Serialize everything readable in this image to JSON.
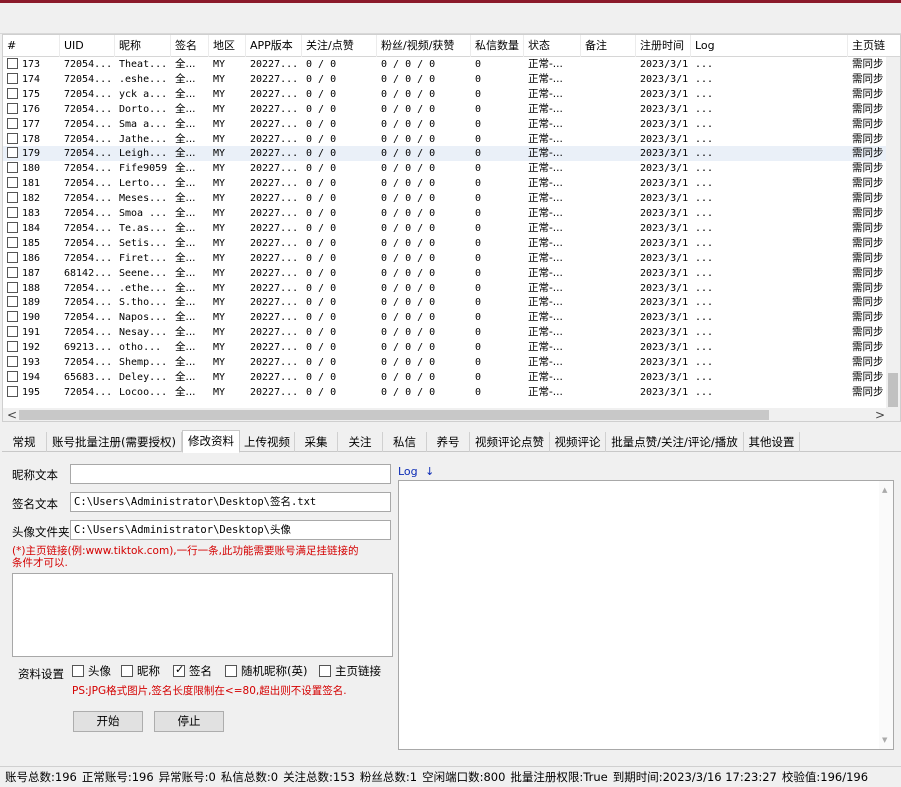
{
  "columns": [
    "#",
    "UID",
    "昵称",
    "签名",
    "地区",
    "APP版本",
    "关注/点赞",
    "粉丝/视频/获赞",
    "私信数量",
    "状态",
    "备注",
    "注册时间",
    "Log",
    "主页链"
  ],
  "rows": [
    [
      "173",
      "72054...",
      "Theat...",
      "全...",
      "MY",
      "20227...",
      "0 / 0",
      "0 / 0 / 0",
      "0",
      "正常-...",
      "",
      "2023/3/1",
      "...",
      "需同步"
    ],
    [
      "174",
      "72054...",
      ".eshe...",
      "全...",
      "MY",
      "20227...",
      "0 / 0",
      "0 / 0 / 0",
      "0",
      "正常-...",
      "",
      "2023/3/1",
      "...",
      "需同步"
    ],
    [
      "175",
      "72054...",
      "yck a...",
      "全...",
      "MY",
      "20227...",
      "0 / 0",
      "0 / 0 / 0",
      "0",
      "正常-...",
      "",
      "2023/3/1",
      "...",
      "需同步"
    ],
    [
      "176",
      "72054...",
      "Dorto...",
      "全...",
      "MY",
      "20227...",
      "0 / 0",
      "0 / 0 / 0",
      "0",
      "正常-...",
      "",
      "2023/3/1",
      "...",
      "需同步"
    ],
    [
      "177",
      "72054...",
      "Sma a...",
      "全...",
      "MY",
      "20227...",
      "0 / 0",
      "0 / 0 / 0",
      "0",
      "正常-...",
      "",
      "2023/3/1",
      "...",
      "需同步"
    ],
    [
      "178",
      "72054...",
      "Jathe...",
      "全...",
      "MY",
      "20227...",
      "0 / 0",
      "0 / 0 / 0",
      "0",
      "正常-...",
      "",
      "2023/3/1",
      "...",
      "需同步"
    ],
    [
      "179",
      "72054...",
      "Leigh...",
      "全...",
      "MY",
      "20227...",
      "0 / 0",
      "0 / 0 / 0",
      "0",
      "正常-...",
      "",
      "2023/3/1",
      "...",
      "需同步"
    ],
    [
      "180",
      "72054...",
      "Fife9059",
      "全...",
      "MY",
      "20227...",
      "0 / 0",
      "0 / 0 / 0",
      "0",
      "正常-...",
      "",
      "2023/3/1",
      "...",
      "需同步"
    ],
    [
      "181",
      "72054...",
      "Lerto...",
      "全...",
      "MY",
      "20227...",
      "0 / 0",
      "0 / 0 / 0",
      "0",
      "正常-...",
      "",
      "2023/3/1",
      "...",
      "需同步"
    ],
    [
      "182",
      "72054...",
      "Meses...",
      "全...",
      "MY",
      "20227...",
      "0 / 0",
      "0 / 0 / 0",
      "0",
      "正常-...",
      "",
      "2023/3/1",
      "...",
      "需同步"
    ],
    [
      "183",
      "72054...",
      "Smoa ...",
      "全...",
      "MY",
      "20227...",
      "0 / 0",
      "0 / 0 / 0",
      "0",
      "正常-...",
      "",
      "2023/3/1",
      "...",
      "需同步"
    ],
    [
      "184",
      "72054...",
      "Te.as...",
      "全...",
      "MY",
      "20227...",
      "0 / 0",
      "0 / 0 / 0",
      "0",
      "正常-...",
      "",
      "2023/3/1",
      "...",
      "需同步"
    ],
    [
      "185",
      "72054...",
      "Setis...",
      "全...",
      "MY",
      "20227...",
      "0 / 0",
      "0 / 0 / 0",
      "0",
      "正常-...",
      "",
      "2023/3/1",
      "...",
      "需同步"
    ],
    [
      "186",
      "72054...",
      "Firet...",
      "全...",
      "MY",
      "20227...",
      "0 / 0",
      "0 / 0 / 0",
      "0",
      "正常-...",
      "",
      "2023/3/1",
      "...",
      "需同步"
    ],
    [
      "187",
      "68142...",
      "Seene...",
      "全...",
      "MY",
      "20227...",
      "0 / 0",
      "0 / 0 / 0",
      "0",
      "正常-...",
      "",
      "2023/3/1",
      "...",
      "需同步"
    ],
    [
      "188",
      "72054...",
      ".ethe...",
      "全...",
      "MY",
      "20227...",
      "0 / 0",
      "0 / 0 / 0",
      "0",
      "正常-...",
      "",
      "2023/3/1",
      "...",
      "需同步"
    ],
    [
      "189",
      "72054...",
      "S.tho...",
      "全...",
      "MY",
      "20227...",
      "0 / 0",
      "0 / 0 / 0",
      "0",
      "正常-...",
      "",
      "2023/3/1",
      "...",
      "需同步"
    ],
    [
      "190",
      "72054...",
      "Napos...",
      "全...",
      "MY",
      "20227...",
      "0 / 0",
      "0 / 0 / 0",
      "0",
      "正常-...",
      "",
      "2023/3/1",
      "...",
      "需同步"
    ],
    [
      "191",
      "72054...",
      "Nesay...",
      "全...",
      "MY",
      "20227...",
      "0 / 0",
      "0 / 0 / 0",
      "0",
      "正常-...",
      "",
      "2023/3/1",
      "...",
      "需同步"
    ],
    [
      "192",
      "69213...",
      "otho...",
      "全...",
      "MY",
      "20227...",
      "0 / 0",
      "0 / 0 / 0",
      "0",
      "正常-...",
      "",
      "2023/3/1",
      "...",
      "需同步"
    ],
    [
      "193",
      "72054...",
      "Shemp...",
      "全...",
      "MY",
      "20227...",
      "0 / 0",
      "0 / 0 / 0",
      "0",
      "正常-...",
      "",
      "2023/3/1",
      "...",
      "需同步"
    ],
    [
      "194",
      "65683...",
      "Deley...",
      "全...",
      "MY",
      "20227...",
      "0 / 0",
      "0 / 0 / 0",
      "0",
      "正常-...",
      "",
      "2023/3/1",
      "...",
      "需同步"
    ],
    [
      "195",
      "72054...",
      "Locoo...",
      "全...",
      "MY",
      "20227...",
      "0 / 0",
      "0 / 0 / 0",
      "0",
      "正常-...",
      "",
      "2023/3/1",
      "...",
      "需同步"
    ]
  ],
  "selected_row": "179",
  "tabs": [
    "常规",
    "账号批量注册(需要授权)",
    "修改资料",
    "上传视频",
    "采集",
    "关注",
    "私信",
    "养号",
    "视频评论点赞",
    "视频评论",
    "批量点赞/关注/评论/播放",
    "其他设置"
  ],
  "active_tab": "修改资料",
  "form": {
    "nickname_label": "昵称文本",
    "nickname_value": "",
    "signature_label": "签名文本",
    "signature_value": "C:\\Users\\Administrator\\Desktop\\签名.txt",
    "avatar_label": "头像文件夹",
    "avatar_value": "C:\\Users\\Administrator\\Desktop\\头像",
    "link_hint_line1": "(*)主页链接(例:www.tiktok.com),一行一条,此功能需要账号满足挂链接的",
    "link_hint_line2": "条件才可以.",
    "settings_label": "资料设置",
    "options": [
      {
        "label": "头像",
        "checked": false
      },
      {
        "label": "昵称",
        "checked": false
      },
      {
        "label": "签名",
        "checked": true
      },
      {
        "label": "随机昵称(英)",
        "checked": false
      },
      {
        "label": "主页链接",
        "checked": false
      }
    ],
    "ps_note": "PS:JPG格式图片,签名长度限制在<=80,超出则不设置签名.",
    "start_label": "开始",
    "stop_label": "停止"
  },
  "log": {
    "label": "Log",
    "arrow": "↓",
    "content": ""
  },
  "status_bar": [
    "账号总数:196",
    "正常账号:196",
    "异常账号:0",
    "私信总数:0",
    "关注总数:153",
    "粉丝总数:1",
    "空闲端口数:800",
    "批量注册权限:True",
    "到期时间:2023/3/16 17:23:27",
    "校验值:196/196"
  ],
  "scroll": {
    "up": "▲",
    "down": "▼",
    "left": "<",
    "right": ">"
  }
}
